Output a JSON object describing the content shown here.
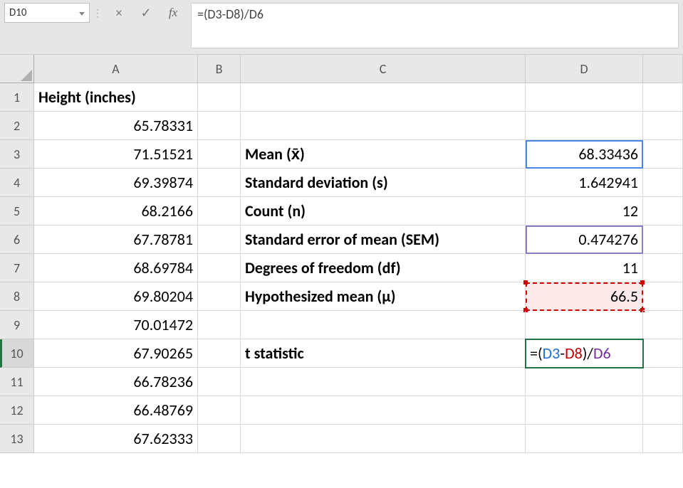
{
  "formula_bar": {
    "cell_ref": "D10",
    "cancel_icon": "×",
    "confirm_icon": "✓",
    "fx_label": "fx",
    "formula_text": "=(D3-D8)/D6"
  },
  "column_headers": [
    "A",
    "B",
    "C",
    "D",
    ""
  ],
  "rows": {
    "1": {
      "A": "Height (inches)",
      "C": "",
      "D": ""
    },
    "2": {
      "A": "65.78331",
      "C": "",
      "D": ""
    },
    "3": {
      "A": "71.51521",
      "C": "Mean (x̄)",
      "D": "68.33436"
    },
    "4": {
      "A": "69.39874",
      "C": "Standard deviation (s)",
      "D": "1.642941"
    },
    "5": {
      "A": "68.2166",
      "C": "Count (n)",
      "D": "12"
    },
    "6": {
      "A": "67.78781",
      "C": "Standard error of mean (SEM)",
      "D": "0.474276"
    },
    "7": {
      "A": "68.69784",
      "C": "Degrees of freedom (df)",
      "D": "11"
    },
    "8": {
      "A": "69.80204",
      "C": "Hypothesized mean (μ)",
      "D": "66.5"
    },
    "9": {
      "A": "70.01472",
      "C": "",
      "D": ""
    },
    "10": {
      "A": "67.90265",
      "C": "t statistic"
    },
    "11": {
      "A": "66.78236",
      "C": "",
      "D": ""
    },
    "12": {
      "A": "66.48769",
      "C": "",
      "D": ""
    },
    "13": {
      "A": "67.62333",
      "C": "",
      "D": ""
    }
  },
  "d10_formula_tokens": {
    "eq": "=(",
    "d3": "D3",
    "minus": "-",
    "d8": "D8",
    "paren": ")/",
    "d6": "D6"
  }
}
